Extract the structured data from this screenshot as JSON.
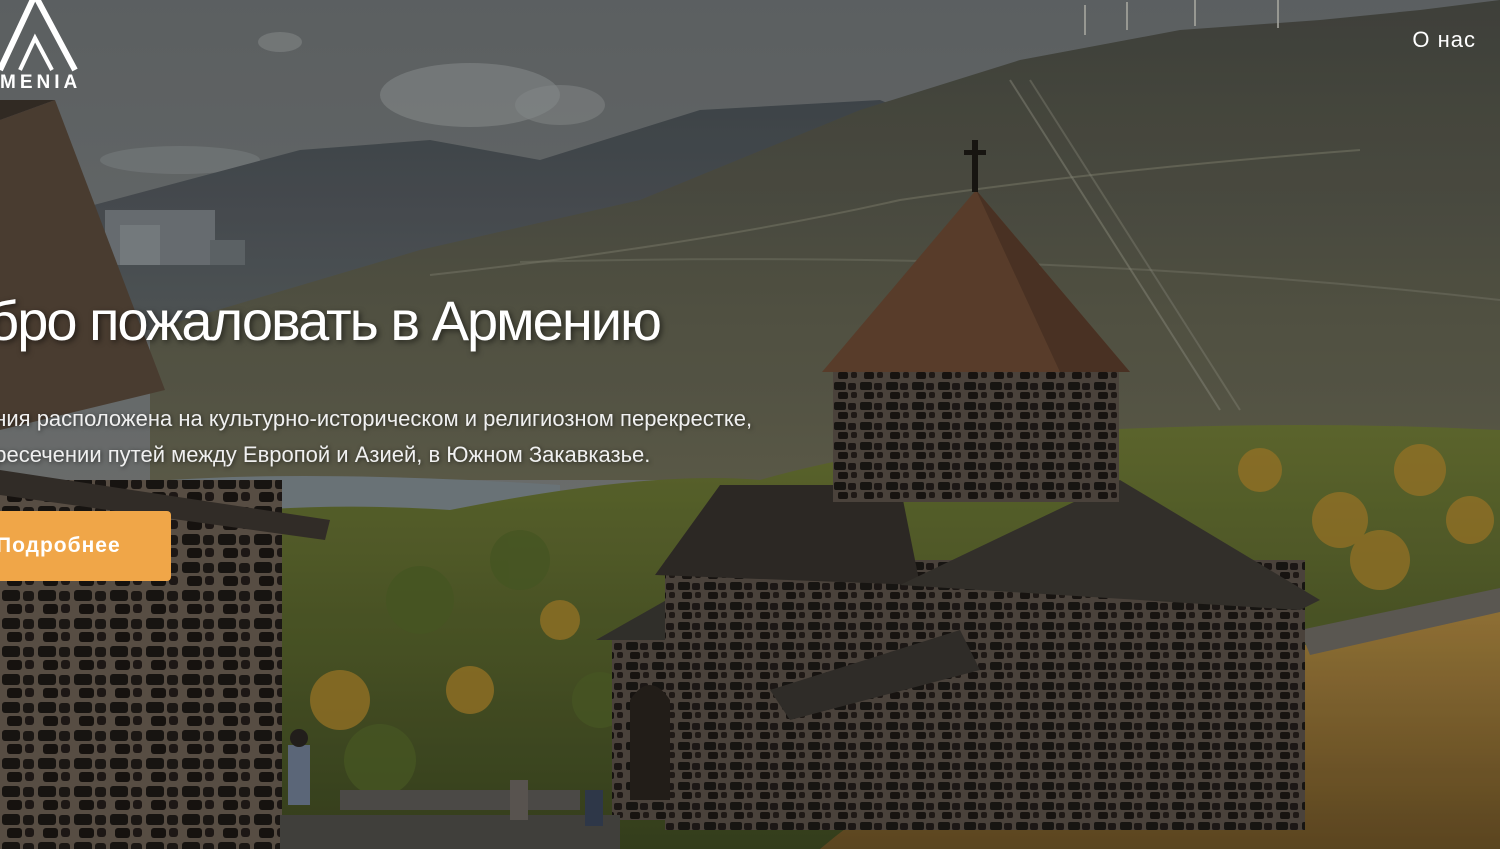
{
  "header": {
    "logo_text": "MENIA",
    "nav_about": "О нас"
  },
  "hero": {
    "title": "обро пожаловать в Армению",
    "description_line1": "ения расположена на культурно-историческом и религиозном перекрестке,",
    "description_line2": "ересечении путей между Европой и Азией, в Южном Закавказье.",
    "cta_label": "Подробнее"
  },
  "colors": {
    "accent": "#f0a648",
    "text": "#ffffff"
  }
}
